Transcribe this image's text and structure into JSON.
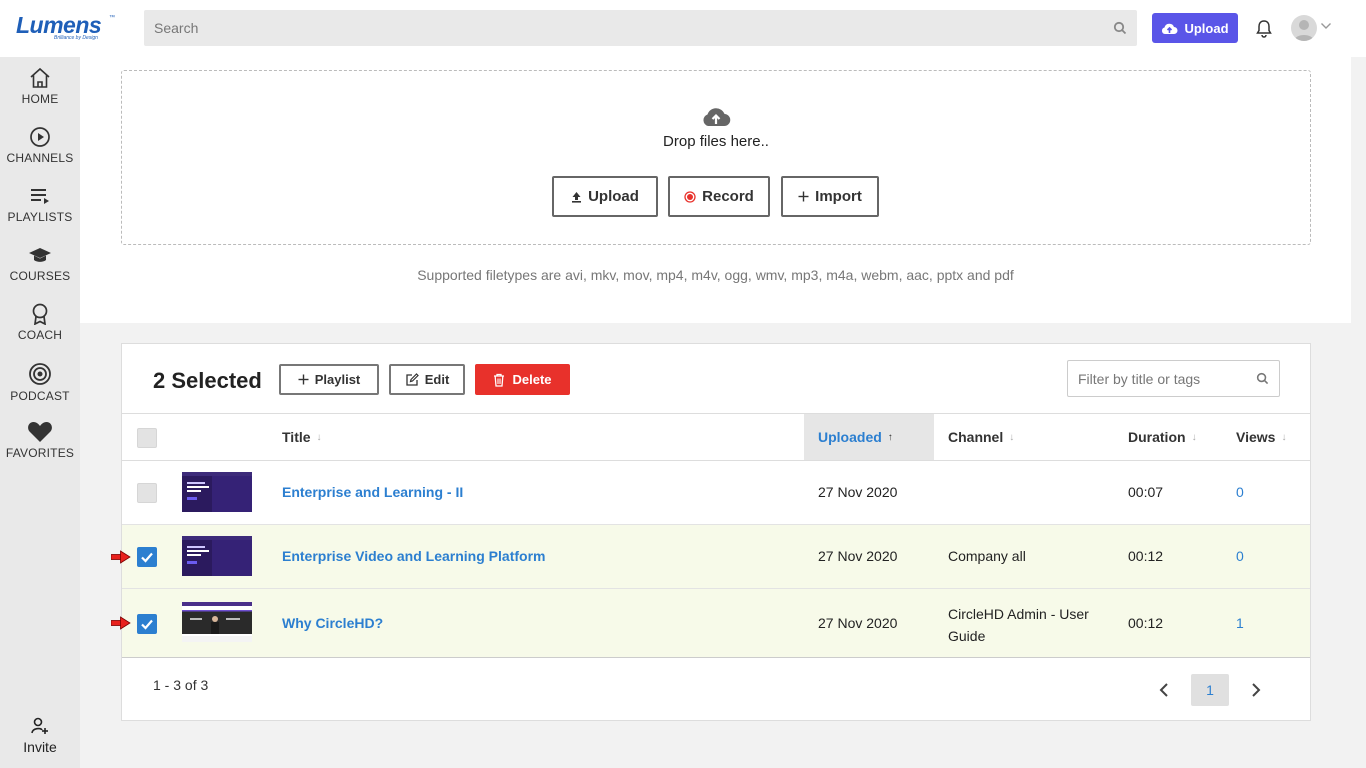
{
  "brand": {
    "logo_text": "Lumens",
    "tagline": "Brilliance by Design",
    "trademark": "™",
    "primary_color": "#5a55e8",
    "link_color": "#2c7fd0",
    "danger_color": "#e8312b"
  },
  "header": {
    "search_placeholder": "Search",
    "upload_label": "Upload",
    "icons": [
      "search-icon",
      "cloud-upload-icon",
      "bell-icon",
      "avatar",
      "chevron-down-icon"
    ]
  },
  "sidebar": {
    "items": [
      {
        "label": "HOME",
        "icon": "home-icon"
      },
      {
        "label": "CHANNELS",
        "icon": "play-circle-icon"
      },
      {
        "label": "PLAYLISTS",
        "icon": "playlist-icon"
      },
      {
        "label": "COURSES",
        "icon": "graduation-cap-icon"
      },
      {
        "label": "COACH",
        "icon": "award-icon"
      },
      {
        "label": "PODCAST",
        "icon": "podcast-icon"
      },
      {
        "label": "FAVORITES",
        "icon": "heart-icon"
      }
    ],
    "invite_label": "Invite"
  },
  "upload": {
    "drop_text": "Drop files here..",
    "upload_label": "Upload",
    "record_label": "Record",
    "import_label": "Import",
    "filetypes_text": "Supported filetypes are avi, mkv, mov, mp4, m4v, ogg, wmv, mp3, m4a, webm, aac, pptx and pdf"
  },
  "toolbar": {
    "selected_text": "2 Selected",
    "playlist_label": "Playlist",
    "edit_label": "Edit",
    "delete_label": "Delete",
    "filter_placeholder": "Filter by title or tags"
  },
  "table": {
    "columns": {
      "title": "Title",
      "uploaded": "Uploaded",
      "channel": "Channel",
      "duration": "Duration",
      "views": "Views"
    },
    "sort": {
      "column": "Uploaded",
      "direction": "ascending"
    },
    "rows": [
      {
        "title": "Enterprise and Learning - II",
        "uploaded": "27 Nov 2020",
        "channel": "",
        "channel_line2": "",
        "duration": "00:07",
        "views": "0",
        "selected": false
      },
      {
        "title": "Enterprise Video and Learning Platform",
        "uploaded": "27 Nov 2020",
        "channel": "Company all",
        "channel_line2": "",
        "duration": "00:12",
        "views": "0",
        "selected": true
      },
      {
        "title": "Why CircleHD?",
        "uploaded": "27 Nov 2020",
        "channel": "CircleHD Admin - User",
        "channel_line2": "Guide",
        "duration": "00:12",
        "views": "1",
        "selected": true
      }
    ]
  },
  "pagination": {
    "range_text": "1 - 3 of 3",
    "current_page": "1"
  }
}
